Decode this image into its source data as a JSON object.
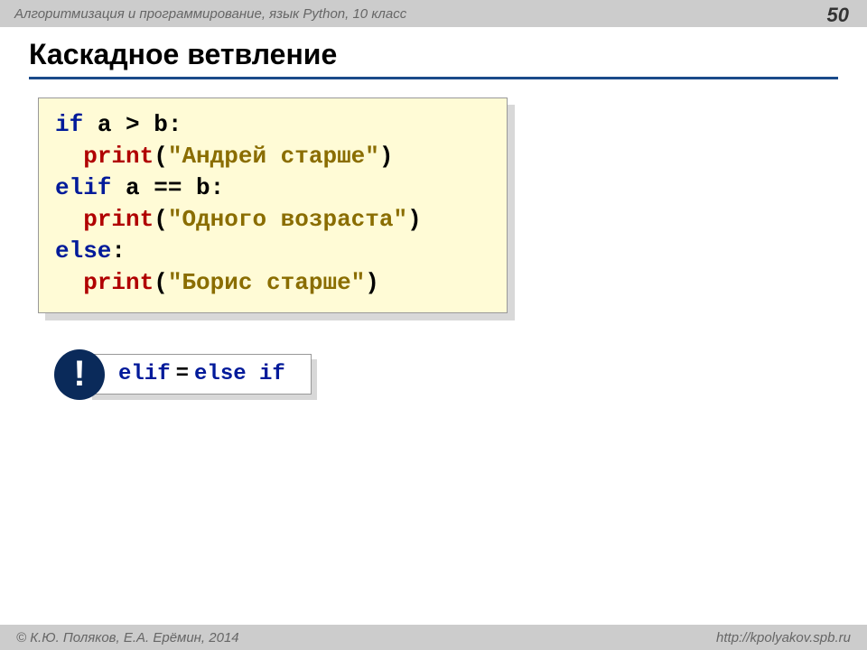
{
  "header": {
    "title": "Алгоритмизация и программирование, язык Python, 10 класс",
    "page_number": "50"
  },
  "slide": {
    "title": "Каскадное ветвление"
  },
  "code": {
    "l1": {
      "kw": "if",
      "expr": " a > b:"
    },
    "l2": {
      "fn": "print",
      "paren_open": "(",
      "str": "\"Андрей старше\"",
      "paren_close": ")"
    },
    "l3": {
      "kw": "elif",
      "expr": " a == b:"
    },
    "l4": {
      "fn": "print",
      "paren_open": "(",
      "str": "\"Одного возраста\"",
      "paren_close": ")"
    },
    "l5": {
      "kw": "else",
      "colon": ":"
    },
    "l6": {
      "fn": "print",
      "paren_open": "(",
      "str": "\"Борис старше\"",
      "paren_close": ")"
    }
  },
  "note": {
    "bang": "!",
    "elif": "elif",
    "eq": "=",
    "else_if": "else if"
  },
  "footer": {
    "copyright": "© К.Ю. Поляков, Е.А. Ерёмин, 2014",
    "url": "http://kpolyakov.spb.ru"
  }
}
